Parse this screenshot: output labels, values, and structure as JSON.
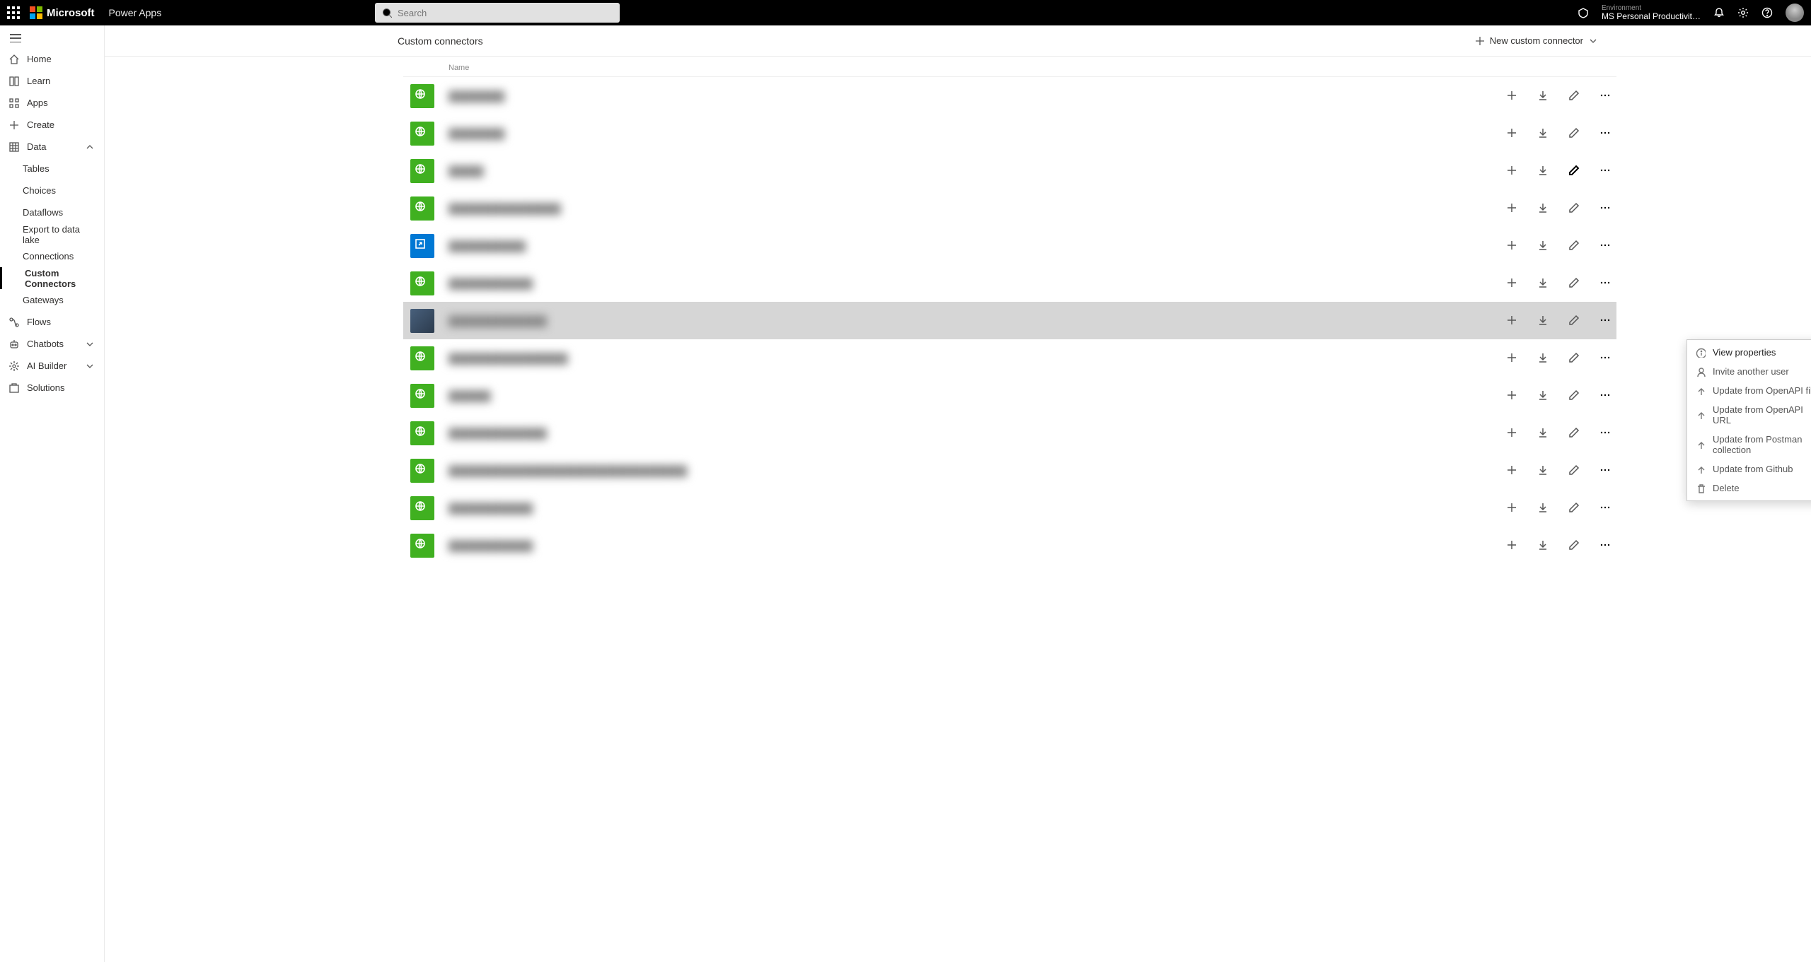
{
  "topbar": {
    "brand": "Microsoft",
    "app": "Power Apps",
    "search_placeholder": "Search",
    "env_label": "Environment",
    "env_value": "MS Personal Productivit…"
  },
  "sidebar": {
    "items": [
      {
        "label": "Home"
      },
      {
        "label": "Learn"
      },
      {
        "label": "Apps"
      },
      {
        "label": "Create"
      },
      {
        "label": "Data",
        "expandable": true,
        "expanded": true
      },
      {
        "label": "Tables",
        "sub": true
      },
      {
        "label": "Choices",
        "sub": true
      },
      {
        "label": "Dataflows",
        "sub": true
      },
      {
        "label": "Export to data lake",
        "sub": true
      },
      {
        "label": "Connections",
        "sub": true
      },
      {
        "label": "Custom Connectors",
        "sub": true,
        "selected": true
      },
      {
        "label": "Gateways",
        "sub": true
      },
      {
        "label": "Flows"
      },
      {
        "label": "Chatbots",
        "expandable": true
      },
      {
        "label": "AI Builder",
        "expandable": true
      },
      {
        "label": "Solutions"
      }
    ]
  },
  "commands": {
    "title": "Custom connectors",
    "new_label": "New custom connector"
  },
  "list": {
    "header": "Name",
    "rows": [
      {
        "icon": "green",
        "name": "████████"
      },
      {
        "icon": "green",
        "name": "████████"
      },
      {
        "icon": "green",
        "name": "█████",
        "edit_active": true
      },
      {
        "icon": "green",
        "name": "████████████████"
      },
      {
        "icon": "blue",
        "name": "███████████"
      },
      {
        "icon": "green",
        "name": "████████████"
      },
      {
        "icon": "photo",
        "name": "██████████████",
        "selected": true,
        "menu_open": true
      },
      {
        "icon": "green",
        "name": "█████████████████"
      },
      {
        "icon": "green",
        "name": "██████"
      },
      {
        "icon": "green",
        "name": "██████████████"
      },
      {
        "icon": "green",
        "name": "██████████████████████████████████"
      },
      {
        "icon": "green",
        "name": "████████████"
      },
      {
        "icon": "green",
        "name": "████████████"
      }
    ]
  },
  "context_menu": {
    "items": [
      {
        "label": "View properties",
        "icon": "info",
        "first": true
      },
      {
        "label": "Invite another user",
        "icon": "user"
      },
      {
        "label": "Update from OpenAPI file",
        "icon": "up"
      },
      {
        "label": "Update from OpenAPI URL",
        "icon": "up"
      },
      {
        "label": "Update from Postman collection",
        "icon": "up"
      },
      {
        "label": "Update from Github",
        "icon": "up"
      },
      {
        "label": "Delete",
        "icon": "trash"
      }
    ]
  }
}
